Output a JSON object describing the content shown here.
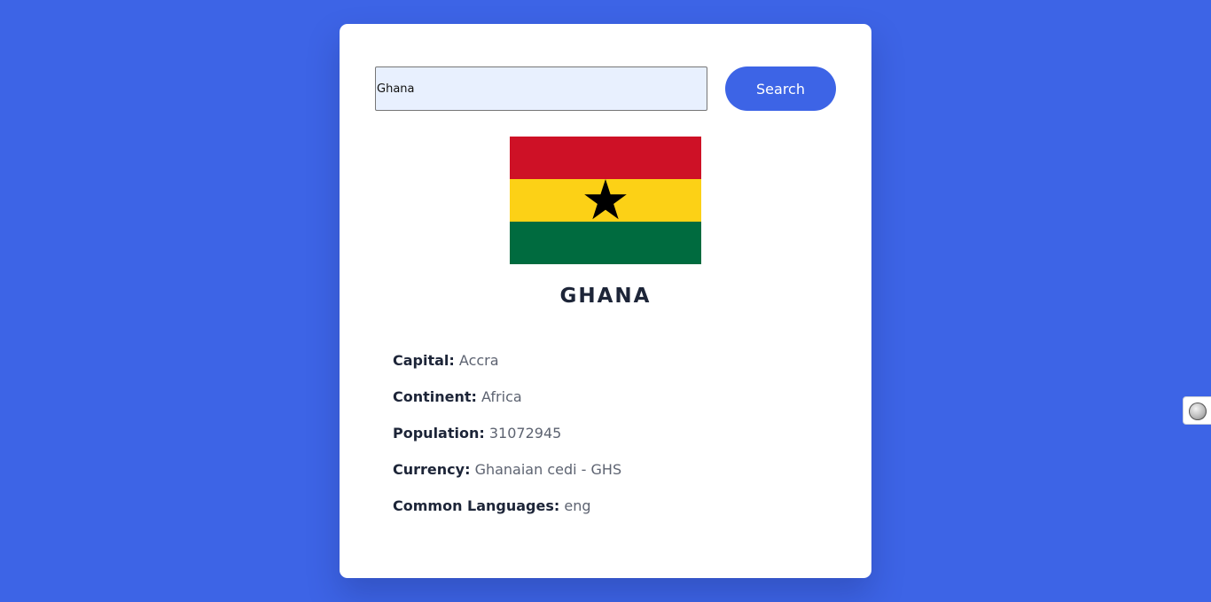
{
  "search": {
    "value": "Ghana",
    "button_label": "Search"
  },
  "flag": {
    "icon": "ghana-flag-icon",
    "colors": {
      "red": "#ce1126",
      "gold": "#fcd116",
      "green": "#006b3f",
      "star": "#000000"
    }
  },
  "country": {
    "name": "GHANA",
    "details": [
      {
        "label": "Capital:",
        "value": "Accra"
      },
      {
        "label": "Continent:",
        "value": "Africa"
      },
      {
        "label": "Population:",
        "value": "31072945"
      },
      {
        "label": "Currency:",
        "value": "Ghanaian cedi - GHS"
      },
      {
        "label": "Common Languages:",
        "value": "eng"
      }
    ]
  },
  "theme": {
    "background": "#3d64e6",
    "accent": "#3d64e6",
    "card": "#ffffff"
  },
  "side_widget": {
    "icon": "extension-orb-icon"
  }
}
